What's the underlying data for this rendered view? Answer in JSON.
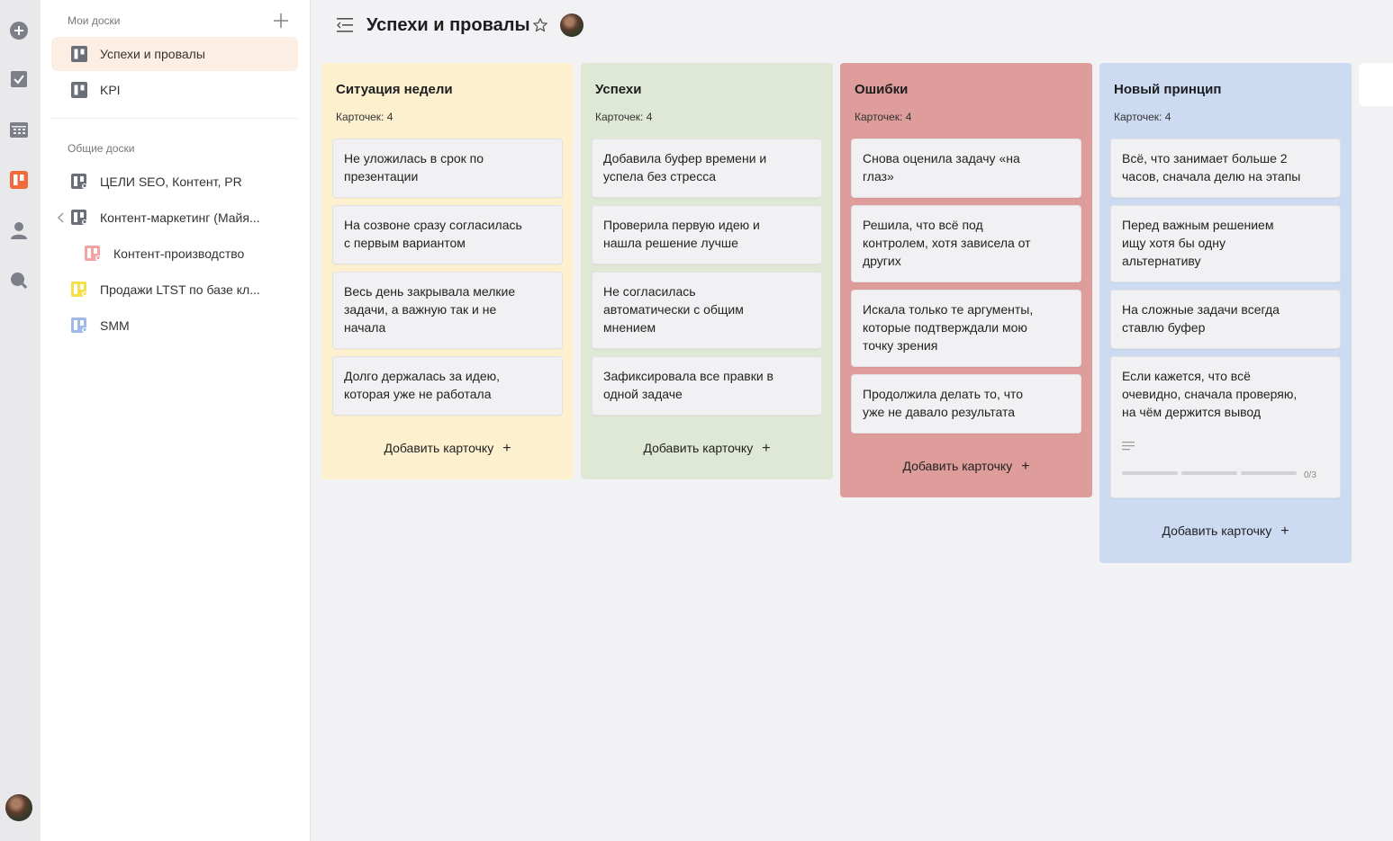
{
  "rail": {
    "icons": [
      "plus-circle-icon",
      "checkbox-icon",
      "calendar-icon",
      "boards-icon",
      "user-icon",
      "search-icon"
    ]
  },
  "sidebar": {
    "my_boards_title": "Мои доски",
    "my_boards": [
      {
        "label": "Успехи и провалы",
        "icon": "board-icon",
        "active": true
      },
      {
        "label": "KPI",
        "icon": "board-icon",
        "active": false
      }
    ],
    "shared_boards_title": "Общие доски",
    "shared_boards": [
      {
        "label": "ЦЕЛИ SEO, Контент, PR",
        "icon": "shared-board-icon",
        "color": "#6b6f78"
      },
      {
        "label": "Контент-маркетинг (Майя...",
        "icon": "shared-board-icon",
        "color": "#6b6f78"
      },
      {
        "label": "Контент-производство",
        "icon": "shared-board-icon",
        "color": "#f2a3a3"
      },
      {
        "label": "Продажи LTST по базе кл...",
        "icon": "shared-board-icon",
        "color": "#f4e04a"
      },
      {
        "label": "SMM",
        "icon": "shared-board-icon",
        "color": "#9fb8e8"
      }
    ]
  },
  "header": {
    "title": "Успехи и провалы"
  },
  "columns": [
    {
      "title": "Ситуация недели",
      "count": "Карточек: 4",
      "color": "#fcf0cf",
      "cards": [
        "Не уложилась в срок по\nпрезентации",
        "На созвоне сразу согласилась\nс первым вариантом",
        "Весь день закрывала мелкие\nзадачи, а важную так и не\nначала",
        "Долго держалась за идею,\nкоторая уже не работала"
      ],
      "add_label": "Добавить карточку"
    },
    {
      "title": "Успехи",
      "count": "Карточек: 4",
      "color": "#dfe8d4",
      "cards": [
        "Добавила буфер времени и\nуспела без стресса",
        "Проверила первую идею и\nнашла решение лучше",
        "Не согласилась\nавтоматически с общим\nмнением",
        "Зафиксировала все правки в\nодной задаче"
      ],
      "add_label": "Добавить карточку"
    },
    {
      "title": "Ошибки",
      "count": "Карточек: 4",
      "color": "#de9c9a",
      "cards": [
        "Снова оценила задачу «на\nглаз»",
        "Решила, что всё под\nконтролем, хотя зависела от\nдругих",
        "Искала только те аргументы,\nкоторые подтверждали мою\nточку зрения",
        "Продолжила делать то, что\nуже не давало результата"
      ],
      "add_label": "Добавить карточку"
    },
    {
      "title": "Новый принцип",
      "count": "Карточек: 4",
      "color": "#ccdaf2",
      "cards": [
        "Всё, что занимает больше 2\nчасов, сначала делю на этапы",
        "Перед важным решением\nищу хотя бы одну\nальтернативу",
        "На сложные задачи всегда\nставлю буфер",
        "Если кажется, что всё\nочевидно, сначала проверяю,\nна чём держится вывод"
      ],
      "checklist": {
        "label": "0/3",
        "done": 0,
        "total": 3
      },
      "add_label": "Добавить карточку"
    }
  ],
  "colors": {
    "active_item_bg": "#fdeee4",
    "accent": "#f06a3a"
  }
}
